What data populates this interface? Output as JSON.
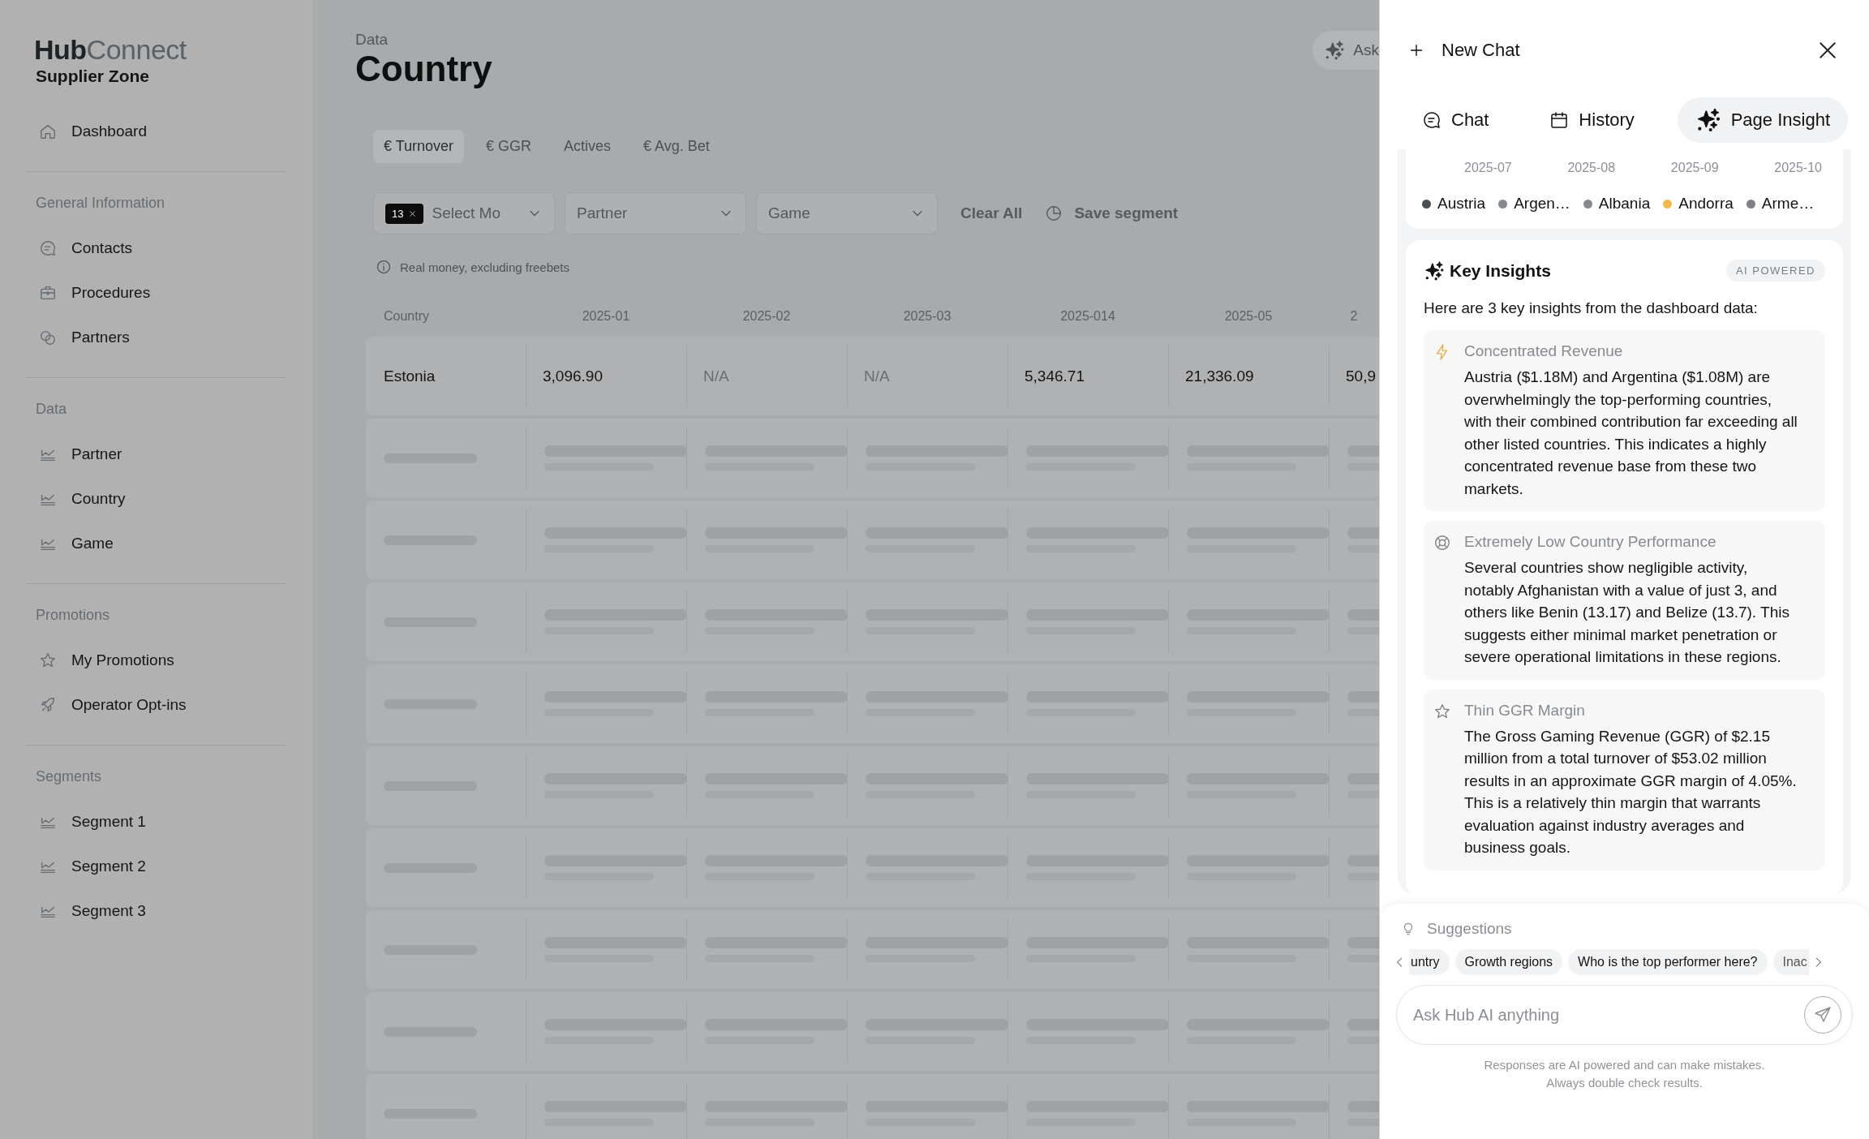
{
  "sidebar": {
    "logo": {
      "primary": "Hub",
      "secondary": "Connect"
    },
    "subtitle": "Supplier Zone",
    "sections": [
      {
        "items": [
          {
            "label": "Dashboard",
            "kind": "home"
          }
        ]
      },
      {
        "title": "General Information",
        "items": [
          {
            "label": "Contacts",
            "kind": "chat"
          },
          {
            "label": "Procedures",
            "kind": "briefcase"
          },
          {
            "label": "Partners",
            "kind": "circles"
          }
        ]
      },
      {
        "title": "Data",
        "items": [
          {
            "label": "Partner",
            "kind": "chart"
          },
          {
            "label": "Country",
            "kind": "chart"
          },
          {
            "label": "Game",
            "kind": "chart"
          }
        ]
      },
      {
        "title": "Promotions",
        "items": [
          {
            "label": "My Promotions",
            "kind": "star"
          },
          {
            "label": "Operator Opt-ins",
            "kind": "rocket"
          }
        ]
      },
      {
        "title": "Segments",
        "items": [
          {
            "label": "Segment 1",
            "kind": "chart"
          },
          {
            "label": "Segment 2",
            "kind": "chart"
          },
          {
            "label": "Segment 3",
            "kind": "chart"
          }
        ]
      }
    ]
  },
  "header": {
    "breadcrumb": "Data",
    "title": "Country",
    "ask_button": "Ask"
  },
  "metric_tabs": [
    {
      "label": "€ Turnover",
      "selected": true
    },
    {
      "label": "€ GGR",
      "selected": false
    },
    {
      "label": "Actives",
      "selected": false
    },
    {
      "label": "€ Avg. Bet",
      "selected": false
    }
  ],
  "filters": {
    "month_select": {
      "badge": "13",
      "placeholder": "Select Mo"
    },
    "partner_select": {
      "placeholder": "Partner"
    },
    "game_select": {
      "placeholder": "Game"
    },
    "clear_all": "Clear All",
    "save_segment": "Save segment"
  },
  "note": "Real money, excluding freebets",
  "table": {
    "columns": [
      "Country",
      "2025-01",
      "2025-02",
      "2025-03",
      "2025-014",
      "2025-05",
      "2"
    ],
    "rows": [
      {
        "kind": "data",
        "cells": [
          {
            "text": "Estonia",
            "muted": false
          },
          {
            "text": "3,096.90",
            "muted": false
          },
          {
            "text": "N/A",
            "muted": true
          },
          {
            "text": "N/A",
            "muted": true
          },
          {
            "text": "5,346.71",
            "muted": false
          },
          {
            "text": "21,336.09",
            "muted": false
          },
          {
            "text": "50,9",
            "muted": false
          }
        ]
      },
      {
        "kind": "loading"
      },
      {
        "kind": "loading"
      },
      {
        "kind": "loading"
      },
      {
        "kind": "loading"
      },
      {
        "kind": "loading"
      },
      {
        "kind": "loading"
      },
      {
        "kind": "loading"
      },
      {
        "kind": "loading"
      },
      {
        "kind": "loading"
      }
    ]
  },
  "panel": {
    "new_chat": "New Chat",
    "tabs": [
      {
        "label": "Chat",
        "kind": "chat",
        "selected": false
      },
      {
        "label": "History",
        "kind": "calendar",
        "selected": false
      },
      {
        "label": "Page Insight",
        "kind": "sparkle",
        "selected": true
      }
    ],
    "chart": {
      "x_labels": [
        "2025-07",
        "2025-08",
        "2025-09",
        "2025-10"
      ],
      "legend": [
        {
          "label": "Austria",
          "color": "#4a4f54"
        },
        {
          "label": "Argen…",
          "color": "#868a8e"
        },
        {
          "label": "Albania",
          "color": "#868a8e"
        },
        {
          "label": "Andorra",
          "color": "#f0b94a"
        },
        {
          "label": "Arme…",
          "color": "#7d8186"
        }
      ]
    },
    "insights": {
      "title": "Key Insights",
      "badge": "AI POWERED",
      "intro": "Here are 3 key insights from the dashboard data:",
      "items": [
        {
          "kind": "bolt",
          "title": "Concentrated Revenue",
          "body": "Austria ($1.18M) and Argentina ($1.08M) are overwhelmingly the top-performing countries, with their combined contribution far exceeding all other listed countries. This indicates a highly concentrated revenue base from these two markets."
        },
        {
          "kind": "lifebuoy",
          "title": "Extremely Low Country Performance",
          "body": "Several countries show negligible activity, notably Afghanistan with a value of just 3, and others like Benin (13.17) and Belize (13.7). This suggests either minimal market penetration or severe operational limitations in these regions."
        },
        {
          "kind": "star",
          "title": "Thin GGR Margin",
          "body": "The Gross Gaming Revenue (GGR) of $2.15 million from a total turnover of $53.02 million results in an approximate GGR margin of 4.05%. This is a relatively thin margin that warrants evaluation against industry averages and business goals."
        }
      ]
    },
    "suggestions": {
      "title": "Suggestions",
      "chips": [
        {
          "label": "untry",
          "kind": "cut_left"
        },
        {
          "label": "Growth regions",
          "kind": "full"
        },
        {
          "label": "Who is the top performer here?",
          "kind": "full"
        },
        {
          "label": "Inac",
          "kind": "cut_right"
        }
      ]
    },
    "input": {
      "placeholder": "Ask Hub AI anything"
    },
    "disclaimer": [
      "Responses are AI powered and can make mistakes.",
      "Always double check results."
    ]
  }
}
